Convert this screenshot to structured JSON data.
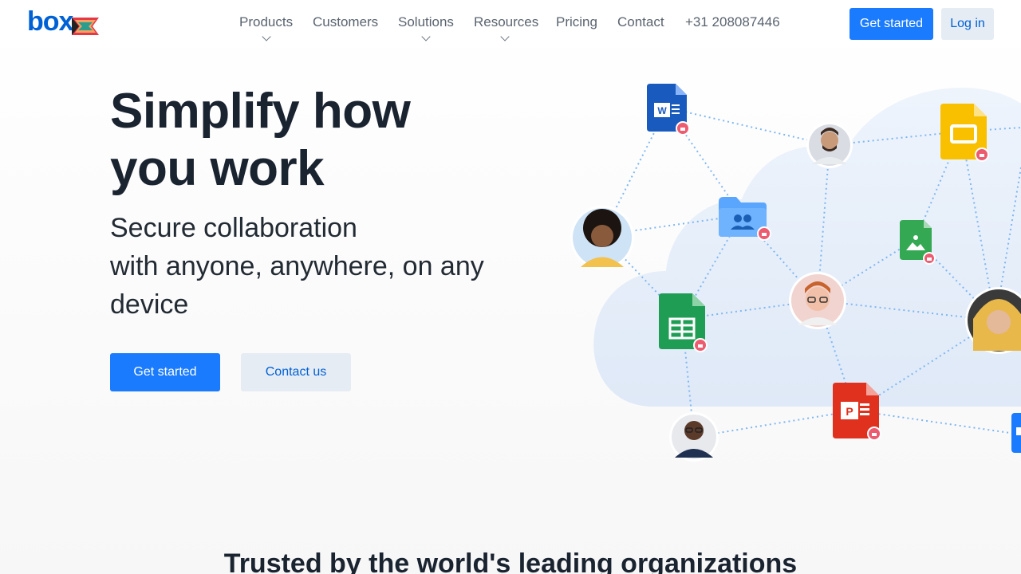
{
  "header": {
    "logo_text": "box",
    "nav": [
      {
        "label": "Products",
        "has_dropdown": true
      },
      {
        "label": "Customers",
        "has_dropdown": false
      },
      {
        "label": "Solutions",
        "has_dropdown": true
      },
      {
        "label": "Resources",
        "has_dropdown": true
      },
      {
        "label": "Pricing",
        "has_dropdown": false
      },
      {
        "label": "Contact",
        "has_dropdown": false
      },
      {
        "label": "+31 208087446",
        "has_dropdown": false
      }
    ],
    "get_started_label": "Get started",
    "login_label": "Log in"
  },
  "hero": {
    "title_line1": "Simplify how",
    "title_line2": "you work",
    "subtitle_line1": "Secure collaboration",
    "subtitle_line2": "with anyone, anywhere, on any",
    "subtitle_line3": "device",
    "primary_button": "Get started",
    "secondary_button": "Contact us"
  },
  "illustration": {
    "file_icons": [
      "word-file-icon",
      "slides-file-icon",
      "folder-shared-icon",
      "image-file-icon",
      "sheets-file-icon",
      "powerpoint-file-icon",
      "doc-file-icon"
    ],
    "colors": {
      "word": "#185abd",
      "slides": "#f9c000",
      "folder": "#5aa6ff",
      "image": "#34a853",
      "sheets": "#1f9d55",
      "powerpoint": "#e0301e",
      "lock_badge": "#ec5b6f"
    }
  },
  "trusted_heading": "Trusted by the world's leading organizations",
  "colors": {
    "brand_blue": "#0061d5",
    "primary_button": "#1a7bff",
    "secondary_button": "#e6ecf3"
  }
}
